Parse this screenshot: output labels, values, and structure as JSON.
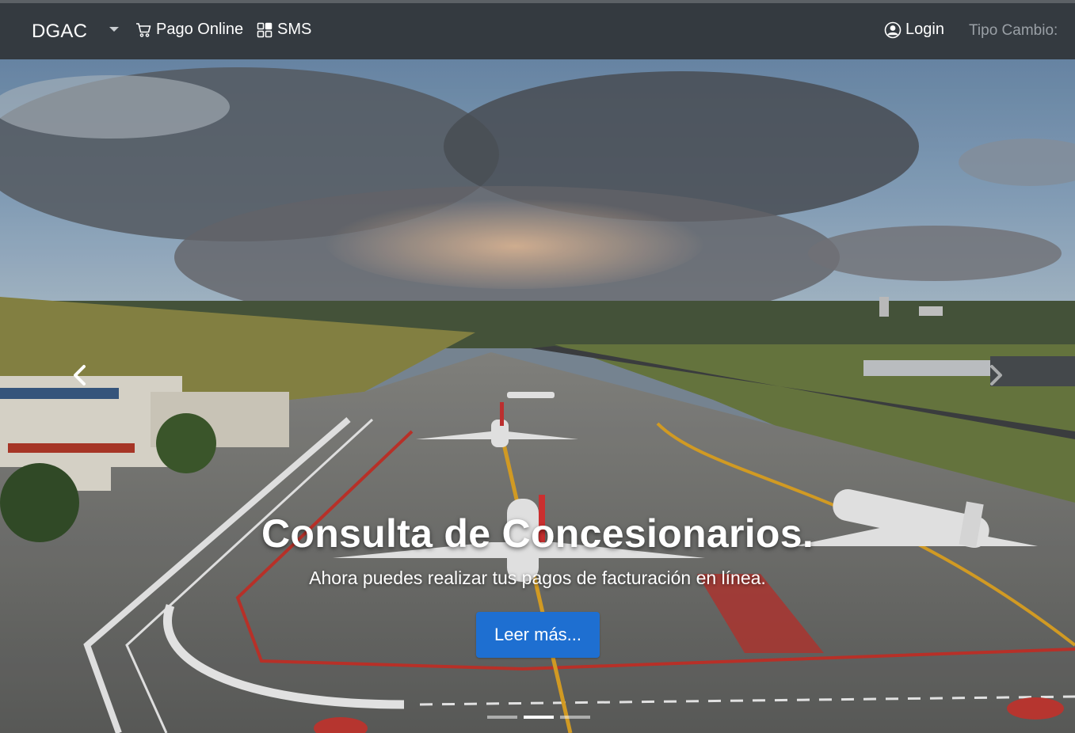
{
  "navbar": {
    "brand": "DGAC",
    "links": {
      "pago": "Pago Online",
      "sms": "SMS",
      "login": "Login"
    },
    "exchange_label": "Tipo Cambio:"
  },
  "carousel": {
    "slide": {
      "title": "Consulta de Concesionarios.",
      "subtitle": "Ahora puedes realizar tus pagos de facturación en línea.",
      "button": "Leer más..."
    },
    "indicator_count": 3,
    "active_indicator": 1
  },
  "icons": {
    "caret": "chevron-down-icon",
    "pago": "cart-icon",
    "sms": "grid-icon",
    "login": "user-circle-icon",
    "prev": "chevron-left-icon",
    "next": "chevron-right-icon"
  },
  "colors": {
    "navbar": "#343a40",
    "button": "#1e6fd1",
    "muted_text": "#9aa0a6"
  }
}
